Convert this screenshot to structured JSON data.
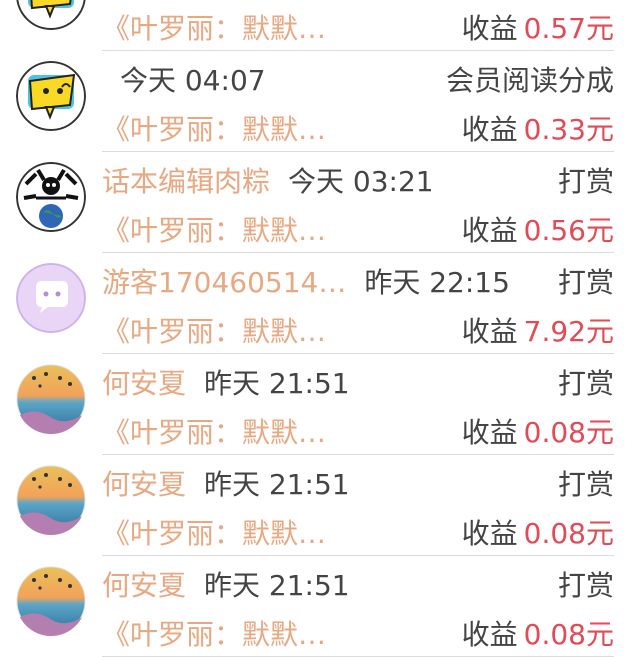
{
  "records": [
    {
      "avatar": "yellow-cartoon",
      "name": "",
      "time": "",
      "type": "",
      "book": "《叶罗丽：默默…",
      "earn_label": "收益",
      "earn_amount": "0.57元"
    },
    {
      "avatar": "yellow-cartoon",
      "name": "",
      "time": "今天 04:07",
      "type": "会员阅读分成",
      "book": "《叶罗丽：默默…",
      "earn_label": "收益",
      "earn_amount": "0.33元"
    },
    {
      "avatar": "earth-bw",
      "name": "话本编辑肉粽",
      "time": "今天 03:21",
      "type": "打赏",
      "book": "《叶罗丽：默默…",
      "earn_label": "收益",
      "earn_amount": "0.56元"
    },
    {
      "avatar": "purple-chat",
      "name": "游客170460514…",
      "time": "昨天 22:15",
      "type": "打赏",
      "book": "《叶罗丽：默默…",
      "earn_label": "收益",
      "earn_amount": "7.92元"
    },
    {
      "avatar": "sunset-balloons",
      "name": "何安夏",
      "time": "昨天 21:51",
      "type": "打赏",
      "book": "《叶罗丽：默默…",
      "earn_label": "收益",
      "earn_amount": "0.08元"
    },
    {
      "avatar": "sunset-balloons",
      "name": "何安夏",
      "time": "昨天 21:51",
      "type": "打赏",
      "book": "《叶罗丽：默默…",
      "earn_label": "收益",
      "earn_amount": "0.08元"
    },
    {
      "avatar": "sunset-balloons",
      "name": "何安夏",
      "time": "昨天 21:51",
      "type": "打赏",
      "book": "《叶罗丽：默默…",
      "earn_label": "收益",
      "earn_amount": "0.08元"
    }
  ],
  "colors": {
    "name_accent": "#e8a882",
    "amount_red": "#e24a55",
    "text_gray": "#444444",
    "divider": "#dcdcdc"
  }
}
